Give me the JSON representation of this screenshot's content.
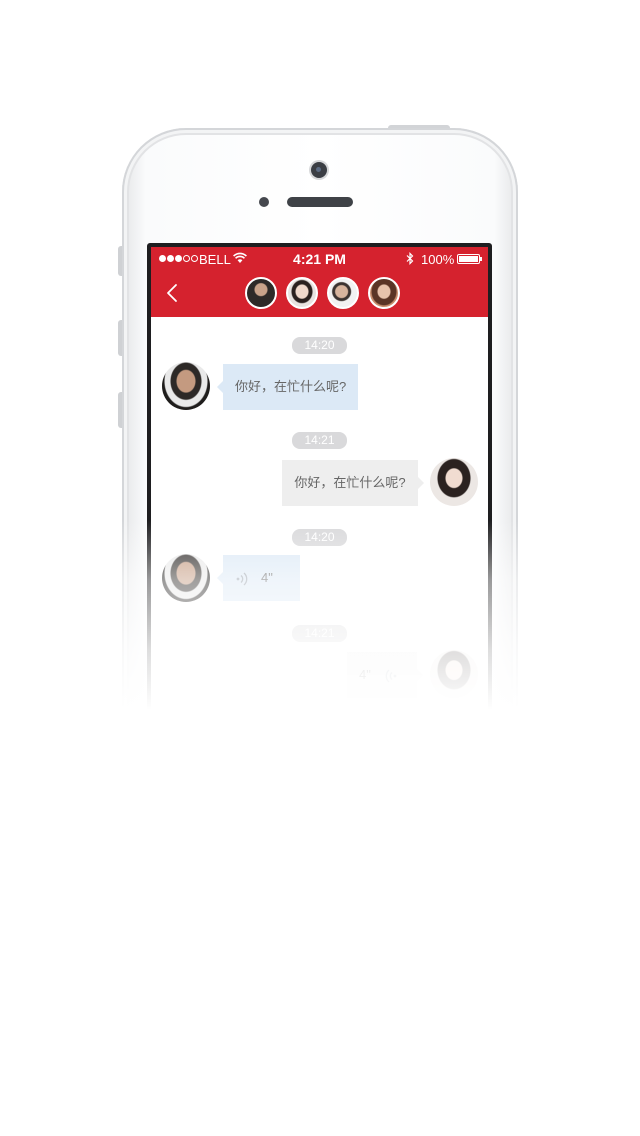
{
  "status_bar": {
    "carrier": "BELL",
    "time": "4:21 PM",
    "battery": "100%"
  },
  "header": {
    "participants": [
      {
        "name": "avatar-male-1",
        "tone": "#3d3a38"
      },
      {
        "name": "avatar-female-1",
        "tone": "#c9b3a6"
      },
      {
        "name": "avatar-male-2",
        "tone": "#b9b3ae"
      },
      {
        "name": "avatar-female-2",
        "tone": "#6d4a3b"
      }
    ]
  },
  "messages": [
    {
      "timestamp": "14:20"
    },
    {
      "direction": "incoming",
      "text": "你好，在忙什么呢?"
    },
    {
      "timestamp": "14:21"
    },
    {
      "direction": "outgoing",
      "text": "你好，在忙什么呢?"
    },
    {
      "timestamp": "14:20"
    },
    {
      "direction": "incoming",
      "type": "voice",
      "duration": "4\""
    },
    {
      "timestamp": "14:21"
    },
    {
      "direction": "outgoing",
      "type": "voice",
      "duration": "4\""
    }
  ],
  "colors": {
    "brand_red": "#d5222e",
    "incoming_bubble": "#dce9f6",
    "outgoing_bubble": "#eeeeee",
    "timestamp_pill": "#d9d9db"
  }
}
